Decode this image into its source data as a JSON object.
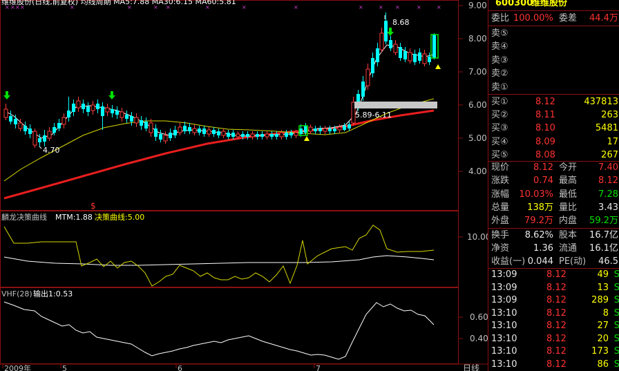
{
  "header": {
    "legend_text": "维维股份(日线,前复权) 均线周期 MA5:7.88 MA30:6.15 MA60:5.81"
  },
  "chart": {
    "price_axis": [
      "9.00",
      "8.00",
      "7.00",
      "6.00",
      "5.00",
      "4.00"
    ],
    "date_axis": [
      "2009年",
      "5",
      "6",
      "7"
    ],
    "period_label": "日线",
    "annotation_high": "8.68",
    "annotation_low": "4.70",
    "gap_label": "5.89-6.11",
    "marker_dollar": "$",
    "colors": {
      "up": "#ff3c3c",
      "down": "#00ffff",
      "ma_short": "#ffffff",
      "ma_mid": "#ffff00",
      "ma_long": "#ff2020",
      "grid": "#8c1010"
    }
  },
  "indicator1": {
    "title": "麟龙决策曲线",
    "mtm_label": "MTM:1.88",
    "curve_label": "决策曲线:5.00",
    "axis_label": "10.00"
  },
  "indicator2": {
    "title": "VHF(28)",
    "output_label": "输出1:0.53",
    "axis_labels": [
      "0.60",
      "0.40"
    ]
  },
  "quote": {
    "code": "600300",
    "name": "维维股份",
    "weibi_label": "委比",
    "weibi_value": "100.00%",
    "weicha_label": "委差",
    "weicha_value": "44.4万",
    "sell": [
      {
        "label": "卖⑤",
        "price": "",
        "vol": ""
      },
      {
        "label": "卖④",
        "price": "",
        "vol": ""
      },
      {
        "label": "卖③",
        "price": "",
        "vol": ""
      },
      {
        "label": "卖②",
        "price": "",
        "vol": ""
      },
      {
        "label": "卖①",
        "price": "",
        "vol": ""
      }
    ],
    "buy": [
      {
        "label": "买①",
        "price": "8.12",
        "vol": "437813"
      },
      {
        "label": "买②",
        "price": "8.11",
        "vol": "263"
      },
      {
        "label": "买③",
        "price": "8.10",
        "vol": "5481"
      },
      {
        "label": "买④",
        "price": "8.09",
        "vol": "17"
      },
      {
        "label": "买⑤",
        "price": "8.08",
        "vol": "267"
      }
    ],
    "stats": [
      {
        "l1": "现价",
        "v1": "8.12",
        "c1": "red",
        "l2": "今开",
        "v2": "7.40",
        "c2": "red"
      },
      {
        "l1": "涨跌",
        "v1": "0.74",
        "c1": "red",
        "l2": "最高",
        "v2": "8.12",
        "c2": "red"
      },
      {
        "l1": "涨幅",
        "v1": "10.03%",
        "c1": "red",
        "l2": "最低",
        "v2": "7.28",
        "c2": "green"
      },
      {
        "l1": "总量",
        "v1": "138万",
        "c1": "yellow",
        "l2": "量比",
        "v2": "3.43",
        "c2": "white"
      },
      {
        "l1": "外盘",
        "v1": "79.2万",
        "c1": "red",
        "l2": "内盘",
        "v2": "59.2万",
        "c2": "green"
      }
    ],
    "finance": [
      {
        "l1": "换手",
        "v1": "8.62%",
        "l2": "股本",
        "v2": "16.7亿"
      },
      {
        "l1": "净资",
        "v1": "1.36",
        "l2": "流通",
        "v2": "16.1亿"
      },
      {
        "l1": "收益(一)",
        "v1": "0.044",
        "l2": "PE(动)",
        "v2": "46.5"
      }
    ],
    "ticks": [
      {
        "time": "13:09",
        "price": "8.12",
        "vol": "49",
        "side": "S"
      },
      {
        "time": "13:09",
        "price": "8.12",
        "vol": "13",
        "side": "S"
      },
      {
        "time": "13:09",
        "price": "8.12",
        "vol": "289",
        "side": "S"
      },
      {
        "time": "13:10",
        "price": "8.12",
        "vol": "8",
        "side": "S"
      },
      {
        "time": "13:10",
        "price": "8.12",
        "vol": "27",
        "side": "S"
      },
      {
        "time": "13:10",
        "price": "8.12",
        "vol": "20",
        "side": "S"
      },
      {
        "time": "13:10",
        "price": "8.12",
        "vol": "173",
        "side": "S"
      },
      {
        "time": "13:10",
        "price": "8.12",
        "vol": "86",
        "side": "S"
      }
    ]
  }
}
